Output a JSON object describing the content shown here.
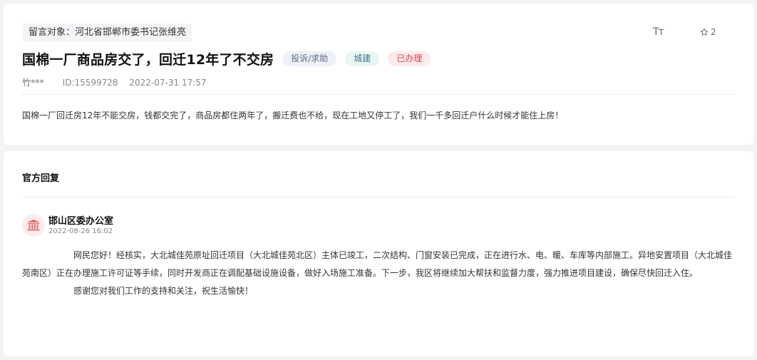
{
  "post": {
    "target": "留言对象：河北省邯郸市委书记张维亮",
    "title": "国棉一厂商品房交了，回迁12年了不交房",
    "tags": [
      "投诉/求助",
      "城建",
      "已办理"
    ],
    "author": "竹***",
    "id": "ID:15599728",
    "datetime": "2022-07-31 17:57",
    "content": "国棉一厂回迁房12年不能交房，钱都交完了，商品房都住两年了，搬迁费也不给，现在工地又停工了，我们一千多回迁户什么时候才能住上房！",
    "font_size_icon": "Tт",
    "star_count": "2"
  },
  "reply": {
    "heading": "官方回复",
    "office": "邯山区委办公室",
    "date": "2022-08-26 16:02",
    "paragraphs": [
      "网民您好！经核实，大北城佳苑原址回迁项目（大北城佳苑北区）主体已竣工，二次结构、门窗安装已完成，正在进行水、电、暖、车库等内部施工。异地安置项目（大北城佳苑南区）正在办理施工许可证等手续，同时开发商正在调配基础设施设备，做好入场施工准备。下一步，我区将继续加大帮扶和监督力度，强力推进项目建设，确保尽快回迁入住。",
      "感谢您对我们工作的支持和关注，祝生活愉快！"
    ]
  },
  "icons": {
    "font_size": "font-size-icon",
    "star": "star-icon",
    "avatar": "government-building-icon"
  },
  "colors": {
    "tag_status_bg": "#fdebeb",
    "tag_status_text": "#d8434b",
    "avatar_bg": "#fdecec",
    "avatar_icon": "#e06b6b"
  }
}
